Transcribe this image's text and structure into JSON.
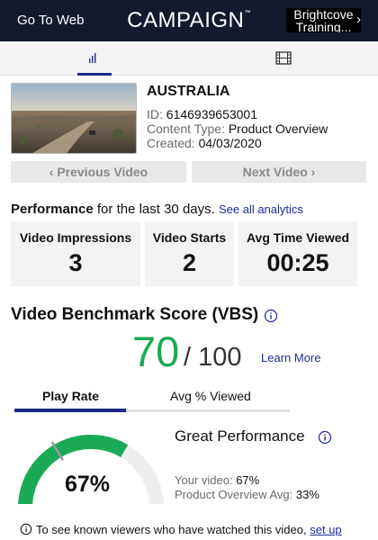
{
  "header": {
    "go_to_web": "Go To Web",
    "logo": "CAMPAIGN",
    "logo_mark": "™",
    "account_line1": "Brightcove",
    "account_line2": "Training..."
  },
  "tabs": [
    {
      "name": "analytics",
      "icon": "bar-chart-icon",
      "active": true
    },
    {
      "name": "media",
      "icon": "film-icon",
      "active": false
    }
  ],
  "video": {
    "title": "AUSTRALIA",
    "id_label": "ID:",
    "id_value": "6146939653001",
    "type_label": "Content Type:",
    "type_value": "Product Overview",
    "created_label": "Created:",
    "created_value": "04/03/2020",
    "thumbnail_icon": "video-thumbnail"
  },
  "navigation": {
    "prev_label": "Previous Video",
    "next_label": "Next Video"
  },
  "performance": {
    "heading": "Performance",
    "period": "for the last 30 days.",
    "link": "See all analytics",
    "stats": [
      {
        "label": "Video Impressions",
        "value": "3"
      },
      {
        "label": "Video Starts",
        "value": "2"
      },
      {
        "label": "Avg Time Viewed",
        "value": "00:25"
      }
    ]
  },
  "vbs": {
    "title": "Video Benchmark Score (VBS)",
    "score": "70",
    "out_of": "/ 100",
    "learn_more": "Learn More",
    "score_color": "#1aaa55",
    "tabs": [
      {
        "label": "Play Rate",
        "active": true
      },
      {
        "label": "Avg % Viewed",
        "active": false
      }
    ],
    "gauge_value_pct": 67,
    "gauge_benchmark_pct": 33,
    "gauge_label": "67%",
    "gauge_color": "#1aaa55",
    "verdict": "Great Performance",
    "your_video_label": "Your video:",
    "your_video_value": "67%",
    "benchmark_label": "Product Overview Avg:",
    "benchmark_value": "33%"
  },
  "footer": {
    "text": "To see known viewers who have watched this video,",
    "link": "set up"
  }
}
